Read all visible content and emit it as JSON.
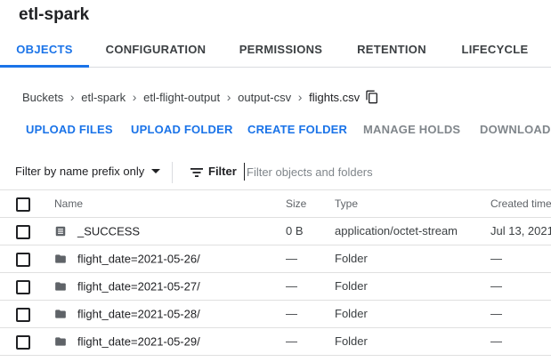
{
  "header": {
    "title": "etl-spark"
  },
  "tabs": [
    {
      "label": "OBJECTS"
    },
    {
      "label": "CONFIGURATION"
    },
    {
      "label": "PERMISSIONS"
    },
    {
      "label": "RETENTION"
    },
    {
      "label": "LIFECYCLE"
    }
  ],
  "breadcrumb": {
    "items": [
      "Buckets",
      "etl-spark",
      "etl-flight-output",
      "output-csv",
      "flights.csv"
    ],
    "separator": "›"
  },
  "actions": {
    "upload_files": "UPLOAD FILES",
    "upload_folder": "UPLOAD FOLDER",
    "create_folder": "CREATE FOLDER",
    "manage_holds": "MANAGE HOLDS",
    "download": "DOWNLOAD"
  },
  "filter": {
    "prefix_label": "Filter by name prefix only",
    "label": "Filter",
    "placeholder": "Filter objects and folders"
  },
  "table": {
    "columns": {
      "name": "Name",
      "size": "Size",
      "type": "Type",
      "created": "Created time"
    },
    "rows": [
      {
        "icon": "file-icon",
        "name": "_SUCCESS",
        "size": "0 B",
        "type": "application/octet-stream",
        "created": "Jul 13, 2021"
      },
      {
        "icon": "folder-icon",
        "name": "flight_date=2021-05-26/",
        "size": "—",
        "type": "Folder",
        "created": "—"
      },
      {
        "icon": "folder-icon",
        "name": "flight_date=2021-05-27/",
        "size": "—",
        "type": "Folder",
        "created": "—"
      },
      {
        "icon": "folder-icon",
        "name": "flight_date=2021-05-28/",
        "size": "—",
        "type": "Folder",
        "created": "—"
      },
      {
        "icon": "folder-icon",
        "name": "flight_date=2021-05-29/",
        "size": "—",
        "type": "Folder",
        "created": "—"
      }
    ]
  },
  "colors": {
    "accent": "#1a73e8",
    "disabled": "#80868b",
    "text": "#202124"
  }
}
